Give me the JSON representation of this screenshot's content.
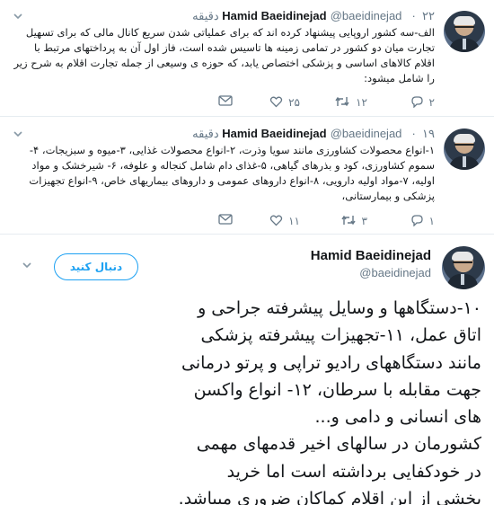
{
  "tweets": [
    {
      "name": "Hamid Baeidinejad",
      "handle": "@baeidinejad",
      "time": "۲۲ دقیقه",
      "text": "الف-سه کشور اروپایی پیشنهاد کرده اند که برای عملیاتی شدن سریع کانال مالی که برای تسهیل تجارت میان دو کشور در تمامی زمینه ها تاسیس شده است، فاز اول آن به پرداختهای مرتبط با اقلام کالاهای اساسی و پزشکی اختصاص یابد، که حوزه ی وسیعی از جمله تجارت اقلام به شرح زیر را شامل میشود:",
      "replies": "۲",
      "retweets": "۱۲",
      "likes": "۲۵",
      "icons": {
        "reply": "reply-icon",
        "retweet": "retweet-icon",
        "like": "heart-icon",
        "dm": "envelope-icon",
        "caret": "chevron-down-icon"
      }
    },
    {
      "name": "Hamid Baeidinejad",
      "handle": "@baeidinejad",
      "time": "۱۹ دقیقه",
      "text": "۱-انواع محصولات کشاورزی مانند سویا وذرت، ۲-انواع محصولات غذایی، ۳-میوه و سبزیجات، ۴-سموم کشاورزی، کود و بذرهای گیاهی، ۵-غذای دام شامل کنجاله و علوفه، ۶- شیرخشک و مواد اولیه، ۷-مواد اولیه دارویی، ۸-انواع داروهای عمومی و داروهای بیماریهای خاص، ۹-انواع تجهیزات پزشکی و بیمارستانی،",
      "replies": "۱",
      "retweets": "۳",
      "likes": "۱۱",
      "icons": {
        "reply": "reply-icon",
        "retweet": "retweet-icon",
        "like": "heart-icon",
        "dm": "envelope-icon",
        "caret": "chevron-down-icon"
      }
    }
  ],
  "focused": {
    "name": "Hamid Baeidinejad",
    "handle": "@baeidinejad",
    "follow_label": "دنبال کنید",
    "lines": [
      "۱۰-دستگاهها و وسایل پیشرفته جراحی و",
      "اتاق عمل، ۱۱-تجهیزات پیشرفته پزشکی",
      "مانند دستگاههای رادیو تراپی و پرتو درمانی",
      "جهت مقابله با سرطان، ۱۲- انواع واکسن",
      "های انسانی و دامی و...",
      "کشورمان در سالهای اخیر قدمهای مهمی",
      "در خودکفایی برداشته است اما خرید",
      "بخشی از این اقلام کماکان ضروری میباشد."
    ]
  },
  "colors": {
    "accent": "#1da1f2",
    "muted": "#657786",
    "text": "#14171a",
    "border": "#e6ecf0"
  }
}
